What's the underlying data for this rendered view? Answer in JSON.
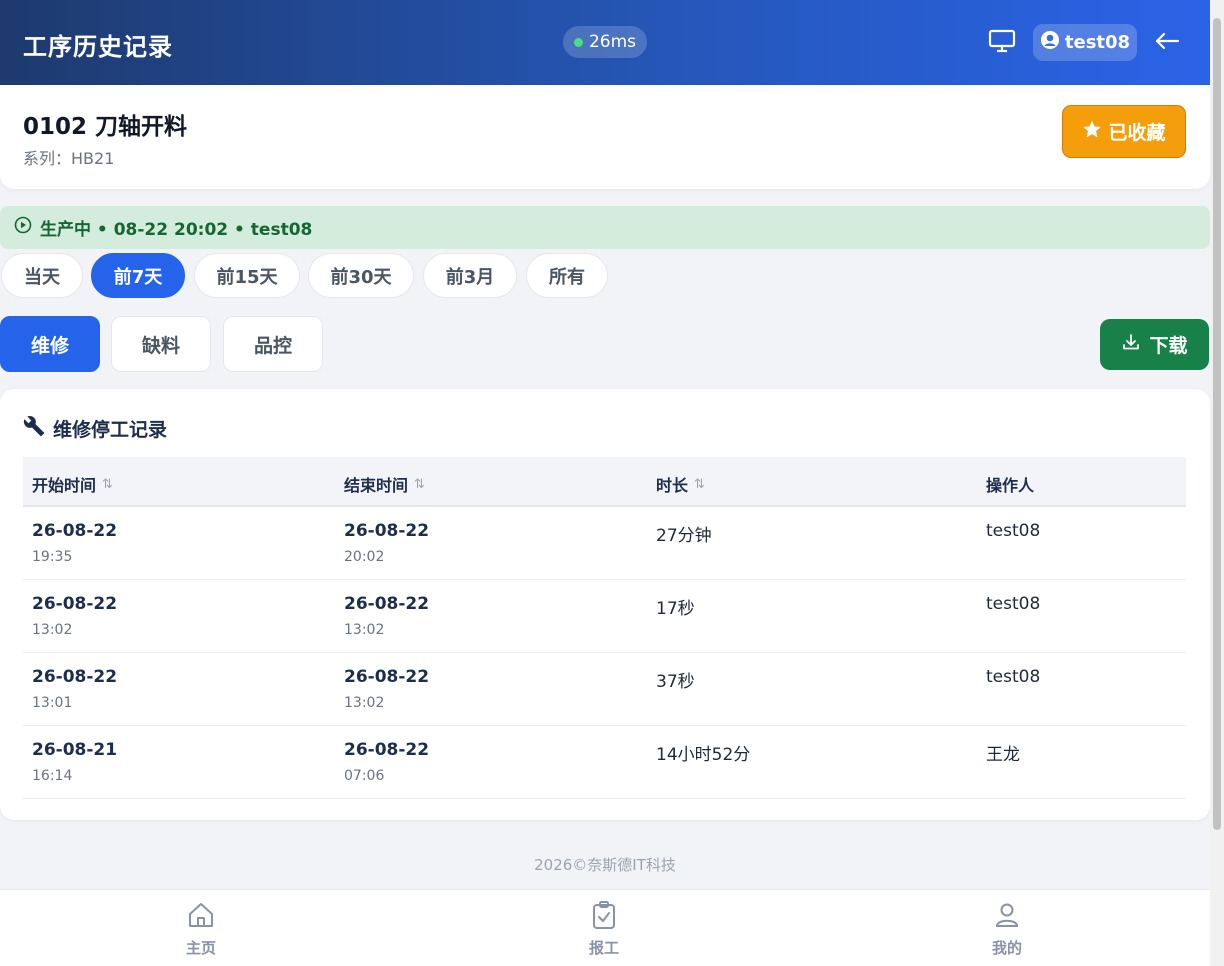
{
  "header": {
    "title": "工序历史记录",
    "latency": "26ms",
    "latency_color": "#4ade80",
    "user": "test08",
    "icons": [
      "monitor-icon",
      "user-circle-icon",
      "arrow-left-icon"
    ]
  },
  "process": {
    "name": "0102 刀轴开料",
    "series": "系列：HB21",
    "favorite_label": "已收藏",
    "favorite_color": "#f59e0b"
  },
  "status": {
    "text": "生产中 • 08-22 20:02 • test08",
    "color": "#166534",
    "background": "#d4ecdc"
  },
  "time_ranges": [
    "当天",
    "前7天",
    "前15天",
    "前30天",
    "前3月",
    "所有"
  ],
  "time_range_selected": "前7天",
  "categories": [
    "维修",
    "缺料",
    "品控"
  ],
  "category_selected": "维修",
  "download_label": "下载",
  "records": {
    "title": "维修停工记录",
    "columns": [
      "开始时间",
      "结束时间",
      "时长",
      "操作人"
    ],
    "rows": [
      {
        "start_date": "26-08-22",
        "start_time": "19:35",
        "end_date": "26-08-22",
        "end_time": "20:02",
        "duration": "27分钟",
        "operator": "test08"
      },
      {
        "start_date": "26-08-22",
        "start_time": "13:02",
        "end_date": "26-08-22",
        "end_time": "13:02",
        "duration": "17秒",
        "operator": "test08"
      },
      {
        "start_date": "26-08-22",
        "start_time": "13:01",
        "end_date": "26-08-22",
        "end_time": "13:02",
        "duration": "37秒",
        "operator": "test08"
      },
      {
        "start_date": "26-08-21",
        "start_time": "16:14",
        "end_date": "26-08-22",
        "end_time": "07:06",
        "duration": "14小时52分",
        "operator": "王龙"
      }
    ]
  },
  "footer": "2026©奈斯德IT科技",
  "bottom_nav": [
    {
      "label": "主页",
      "icon": "home-icon"
    },
    {
      "label": "报工",
      "icon": "clipboard-check-icon"
    },
    {
      "label": "我的",
      "icon": "user-icon"
    }
  ],
  "accent_color": "#2563eb",
  "download_color": "#188049"
}
